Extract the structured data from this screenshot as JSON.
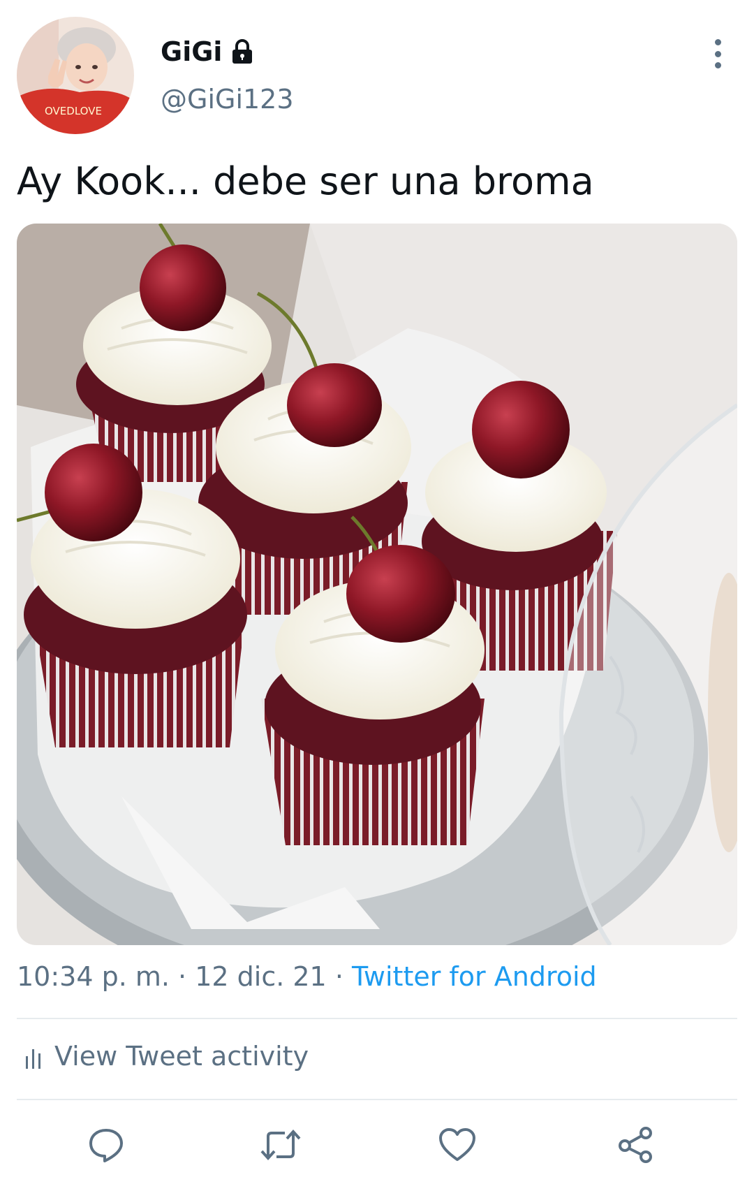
{
  "user": {
    "display_name": "GiGi",
    "handle": "@GiGi123",
    "avatar_shirt_text": "OVEDLOVE",
    "protected_icon": "lock-icon"
  },
  "tweet": {
    "text": "Ay Kook... debe ser una broma",
    "image_icon": "cupcakes-photo"
  },
  "meta": {
    "time": "10:34 p. m.",
    "separator": " · ",
    "date": "12 dic. 21",
    "source": "Twitter for Android"
  },
  "activity": {
    "label": "View Tweet activity",
    "icon": "bar-chart-icon"
  },
  "actions": [
    {
      "name": "reply",
      "icon": "reply-icon"
    },
    {
      "name": "retweet",
      "icon": "retweet-icon"
    },
    {
      "name": "like",
      "icon": "heart-icon"
    },
    {
      "name": "share",
      "icon": "share-icon"
    }
  ],
  "colors": {
    "secondary_text": "#5b7083",
    "link": "#1d9bf0",
    "divider": "#e7ebee"
  }
}
